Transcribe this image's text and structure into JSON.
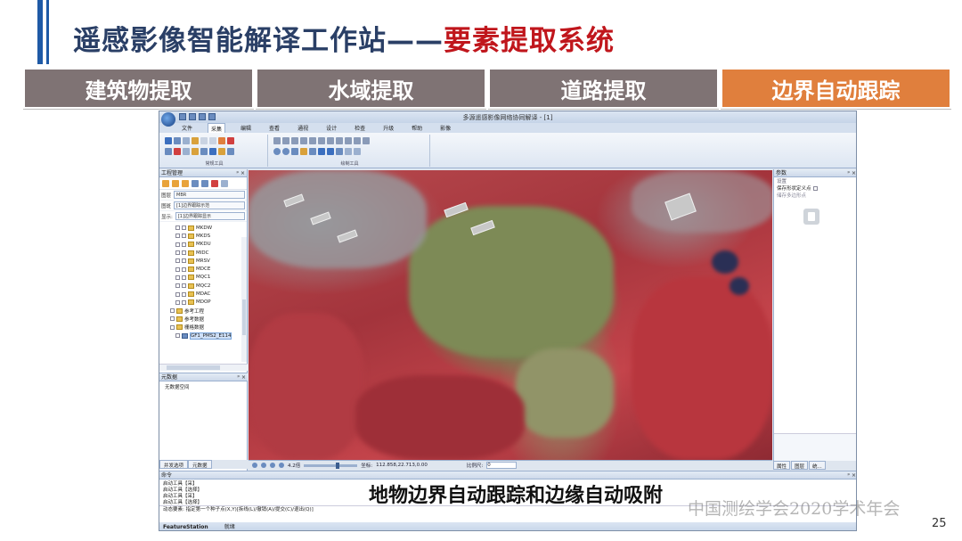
{
  "slide": {
    "title_main": "遥感影像智能解译工作站——",
    "title_highlight": "要素提取系统",
    "tabs": [
      {
        "label": "建筑物提取",
        "active": false
      },
      {
        "label": "水域提取",
        "active": false
      },
      {
        "label": "道路提取",
        "active": false
      },
      {
        "label": "边界自动跟踪",
        "active": true
      }
    ],
    "caption": "地物边界自动跟踪和边缘自动吸附",
    "watermark": "中国测绘学会2020学术年会",
    "page_number": "25",
    "colors": {
      "title_blue": "#2a3f66",
      "title_red": "#c0161c",
      "tab_gray": "#7f7374",
      "tab_active": "#e07f3d"
    }
  },
  "app": {
    "window_title": "多源遥感影像网络协同解译 - [1]",
    "menu": [
      "文件",
      "采集",
      "编辑",
      "查看",
      "通视",
      "设计",
      "检查",
      "升级",
      "帮助",
      "影像"
    ],
    "active_menu": "采集",
    "ribbon_groups": [
      "常规工具",
      "绘制工具"
    ],
    "left_panel": {
      "title": "工程管理",
      "fields": [
        {
          "label": "图层",
          "value": "MBR"
        },
        {
          "label": "图斑",
          "value": "[1]边界跟踪示范"
        },
        {
          "label": "显示:",
          "value": "[1]边界跟踪显示"
        }
      ],
      "tree_items": [
        "MKDW",
        "MKDS",
        "MKDU",
        "MIDC",
        "MRSV",
        "MDCE",
        "MQC1",
        "MQC2",
        "MDAC",
        "MDOP",
        "参考工程",
        "参考数据",
        "栅格数据",
        "GF1_PMS2_E114"
      ],
      "panel2_title": "元数据",
      "panel2_item": "无数据空间",
      "tabs": [
        "并发选项",
        "元数据"
      ]
    },
    "map_status": {
      "zoom": "4.2倍",
      "coord_label": "坐标:",
      "coord_value": "112.858,22.713,0.00",
      "scale_label": "比例尺:",
      "scale_value": "0"
    },
    "right_panel": {
      "title": "参数",
      "section": "设置",
      "options": [
        "保存形状定义点",
        "储存多边形点"
      ],
      "tabs": [
        "属性",
        "图层",
        "统..."
      ]
    },
    "output": {
      "title": "命令",
      "lines": [
        "启动工具【采】",
        "启动工具【选择】",
        "启动工具【采】",
        "启动工具【选择】",
        "启动工具【采】"
      ],
      "command_line": "动态要素: 指定第一个种子点(X,Y)[拆线(L)/撤销(A)/提交(C)/退出(Q)]"
    },
    "app_status": [
      "FeatureStation",
      "就绪"
    ]
  }
}
